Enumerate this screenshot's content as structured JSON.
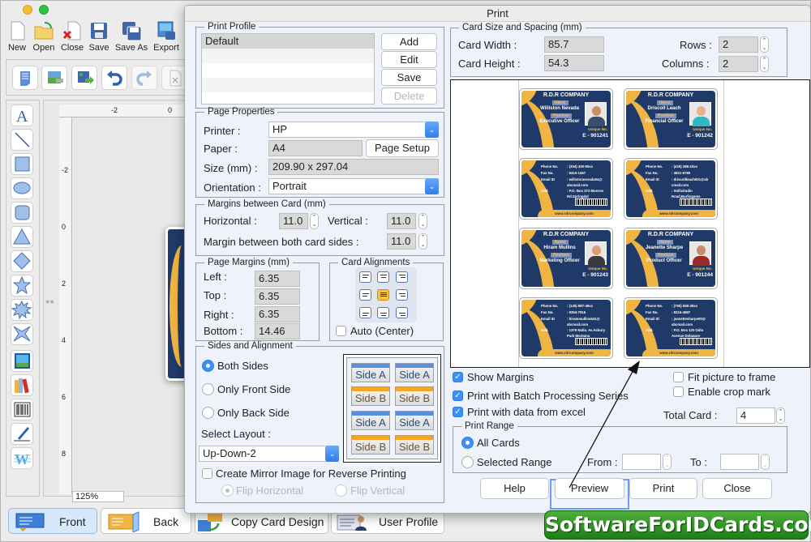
{
  "app": {
    "toolbar": [
      {
        "label": "New",
        "icon": "new-document-icon"
      },
      {
        "label": "Open",
        "icon": "open-folder-icon"
      },
      {
        "label": "Close",
        "icon": "close-document-icon"
      },
      {
        "label": "Save",
        "icon": "save-icon"
      },
      {
        "label": "Save As",
        "icon": "save-as-icon"
      },
      {
        "label": "Export",
        "icon": "export-icon"
      }
    ],
    "zoom_level": "125%",
    "ruler_h": [
      "-2",
      "0"
    ],
    "ruler_v": [
      "-2",
      "0",
      "2",
      "4",
      "6",
      "8"
    ],
    "bottom_tabs": [
      {
        "label": "Front",
        "active": true
      },
      {
        "label": "Back"
      },
      {
        "label": "Copy Card Design"
      },
      {
        "label": "User Profile"
      }
    ]
  },
  "dialog": {
    "title": "Print",
    "print_profile": {
      "legend": "Print Profile",
      "items": [
        "Default",
        "",
        "",
        "",
        ""
      ],
      "buttons": {
        "add": "Add",
        "edit": "Edit",
        "save": "Save",
        "delete": "Delete"
      }
    },
    "page_properties": {
      "legend": "Page Properties",
      "printer_label": "Printer :",
      "printer": "HP",
      "paper_label": "Paper :",
      "paper": "A4",
      "page_setup": "Page Setup",
      "size_label": "Size (mm) :",
      "size": "209.90 x 297.04",
      "orientation_label": "Orientation :",
      "orientation": "Portrait"
    },
    "margins_between_card": {
      "legend": "Margins between Card (mm)",
      "horizontal_label": "Horizontal :",
      "horizontal": "11.0",
      "vertical_label": "Vertical :",
      "vertical": "11.0",
      "both_sides_label": "Margin between both card sides :",
      "both_sides": "11.0"
    },
    "page_margins": {
      "legend": "Page Margins (mm)",
      "left_label": "Left :",
      "left": "6.35",
      "top_label": "Top :",
      "top": "6.35",
      "right_label": "Right :",
      "right": "6.35",
      "bottom_label": "Bottom :",
      "bottom": "14.46"
    },
    "card_alignments": {
      "legend": "Card Alignments",
      "selected": "middle-center",
      "auto_center_label": "Auto (Center)",
      "auto_center": false
    },
    "sides_alignment": {
      "legend": "Sides and Alignment",
      "options": [
        "Both Sides",
        "Only Front Side",
        "Only Back Side"
      ],
      "selected": "Both Sides",
      "select_layout_label": "Select Layout :",
      "layout": "Up-Down-2",
      "layout_preview": [
        "Side A",
        "Side A",
        "Side B",
        "Side B",
        "Side A",
        "Side A",
        "Side B",
        "Side B"
      ],
      "mirror_label": "Create Mirror Image for Reverse Printing",
      "mirror": false,
      "flip_horizontal": "Flip Horizontal",
      "flip_vertical": "Flip Vertical"
    },
    "card_size": {
      "legend": "Card Size and Spacing (mm)",
      "width_label": "Card Width :",
      "width": "85.7",
      "height_label": "Card Height :",
      "height": "54.3",
      "rows_label": "Rows :",
      "rows": "2",
      "columns_label": "Columns :",
      "columns": "2"
    },
    "cards": [
      {
        "company": "R.D.R COMPANY",
        "name_tag": "Name",
        "name": "Williston Nevada",
        "position_tag": "Position",
        "position": "Executive Officer",
        "unique_label": "Unique No.",
        "id": "E - 901241",
        "phone_label": "Phone No.",
        "phone": ": (304) 430-90xx",
        "fax_label": "Fax No.",
        "fax": ": 5410-1457",
        "email_label": "Email ID",
        "email": ": willistonnevada04@",
        "email2": "abcmail.com",
        "add_label": "Add.",
        "add": ": P.O. Box 372 Monroe",
        "add2": "Rd.Springdal",
        "website": "www.rdrcompany.com",
        "skin": "#c98e6a",
        "shirt": "#3a4f6e"
      },
      {
        "company": "R.D.R COMPANY",
        "name_tag": "Name",
        "name": "Driscoll Leach",
        "position_tag": "Position",
        "position": "Financial Officer",
        "unique_label": "Unique No.",
        "id": "E - 901242",
        "phone_label": "Phone No.",
        "phone": ": (425) 288-23xx",
        "fax_label": "Fax No.",
        "fax": ": 4921-6785",
        "email_label": "Email ID",
        "email": ": driscollleach001@ab",
        "email2": "cmail.com",
        "add_label": "Add.",
        "add": ": Sollicitudin",
        "add2": "Road,Burlingame",
        "website": "www.rdrcompany.com",
        "skin": "#e2b48e",
        "shirt": "#2fb7c4"
      },
      {
        "company": "R.D.R COMPANY",
        "name_tag": "Name",
        "name": "Hiram Mullins",
        "position_tag": "Position",
        "position": "Marketing Officer",
        "unique_label": "Unique No.",
        "id": "E - 901243",
        "phone_label": "Phone No.",
        "phone": ": (145) 987-49xx",
        "fax_label": "Fax No.",
        "fax": ": 9354-7915",
        "email_label": "Email ID",
        "email": ": hirammullins641@",
        "email2": "abcmail.com",
        "add_label": "Add.",
        "add": ": 1379 Nulla. Av.Asbury",
        "add2": "Park Montana",
        "website": "www.rdrcompany.com",
        "skin": "#d9a07c",
        "shirt": "#3b3b3b"
      },
      {
        "company": "R.D.R COMPANY",
        "name_tag": "Name",
        "name": "Jeanette Sharpe",
        "position_tag": "Position",
        "position": "Product Officer",
        "unique_label": "Unique No.",
        "id": "E - 901244",
        "phone_label": "Phone No.",
        "phone": ": (750) 558-39xx",
        "fax_label": "Fax No.",
        "fax": ": 8216-4587",
        "email_label": "Email ID",
        "email": ": jeanettesharpe00@",
        "email2": "abcmail.com",
        "add_label": "Add.",
        "add": ": P.O. Box 120 Odio",
        "add2": "Avenue Delaware",
        "website": "www.rdrcompany.com",
        "skin": "#c98a6e",
        "shirt": "#9c2a2a"
      }
    ],
    "options": {
      "show_margins": {
        "label": "Show Margins",
        "checked": true
      },
      "batch": {
        "label": "Print with Batch Processing Series",
        "checked": true
      },
      "excel": {
        "label": "Print with data from excel",
        "checked": true
      },
      "fit_picture": {
        "label": "Fit picture to frame",
        "checked": false
      },
      "crop_mark": {
        "label": "Enable crop mark",
        "checked": false
      },
      "total_card_label": "Total Card :",
      "total_card": "4"
    },
    "print_range": {
      "legend": "Print Range",
      "all_cards": "All Cards",
      "selected_range": "Selected Range",
      "selected": "All Cards",
      "from_label": "From :",
      "from": "",
      "to_label": "To :",
      "to": ""
    },
    "buttons": {
      "help": "Help",
      "preview": "Preview",
      "print": "Print",
      "close": "Close"
    }
  },
  "watermark": "SoftwareForIDCards.com",
  "colors": {
    "accent": "#3d8ff5",
    "card_navy": "#1f3a68",
    "card_gold": "#f0b443",
    "brand_green": "#2a8f22"
  }
}
